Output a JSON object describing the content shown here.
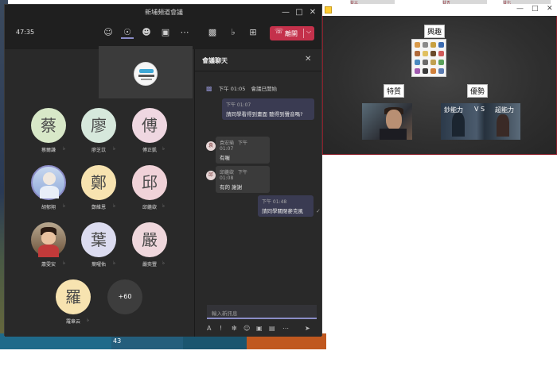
{
  "meeting": {
    "window_title": "新埔頻道會議",
    "timer": "47:35",
    "leave_label": "離開"
  },
  "participants": [
    {
      "initial": "蔡",
      "name": "蔡爾謙",
      "color": "#d8e8c8"
    },
    {
      "initial": "廖",
      "name": "廖芝苡",
      "color": "#d6e8dc"
    },
    {
      "initial": "傅",
      "name": "傅正凱",
      "color": "#efd7e1"
    },
    {
      "initial": "",
      "name": "胡郁翔",
      "color": "#b8c8e8"
    },
    {
      "initial": "鄭",
      "name": "鄭維恩",
      "color": "#f7e3b0"
    },
    {
      "initial": "邱",
      "name": "邱繼欲",
      "color": "#f0d2d8"
    },
    {
      "initial": "",
      "name": "蕭雯安",
      "color": "#8a6a4a"
    },
    {
      "initial": "葉",
      "name": "葉曜佑",
      "color": "#dcdcf0"
    },
    {
      "initial": "嚴",
      "name": "嚴奕豐",
      "color": "#efd7dc"
    },
    {
      "initial": "羅",
      "name": "羅章云",
      "color": "#f7e3b0"
    }
  ],
  "more_participants": "+60",
  "chat": {
    "title": "會議聊天",
    "meeting_started": {
      "time": "下午 01:05",
      "text": "會議已開始"
    },
    "messages": [
      {
        "sender": "",
        "time": "下午 01:07",
        "text": "請同學看得到畫面 聽得到聲音嗎?",
        "mine": true
      },
      {
        "sender": "袁宏瑜",
        "time": "下午 01:07",
        "text": "有喔",
        "mine": false,
        "av": "袁"
      },
      {
        "sender": "邱繼欲",
        "time": "下午 01:08",
        "text": "有的 謝謝",
        "mine": false,
        "av": "邱"
      },
      {
        "sender": "",
        "time": "下午 01:48",
        "text": "請同學關閉麥克風",
        "mine": true
      }
    ],
    "input_placeholder": "輸入新訊息"
  },
  "presentation": {
    "label_interest": "興趣",
    "label_traits": "特質",
    "label_advantages": "優勢",
    "vs_left": "鈔能力",
    "vs_mid": "V S",
    "vs_right": "超能力"
  },
  "taskbar": {
    "number": "43"
  },
  "top_strip": [
    "廿三",
    "廿五",
    "廿七"
  ],
  "colors": {
    "accent": "#8b8cc7",
    "leave": "#c4314b",
    "background": "#1f1f1f"
  }
}
